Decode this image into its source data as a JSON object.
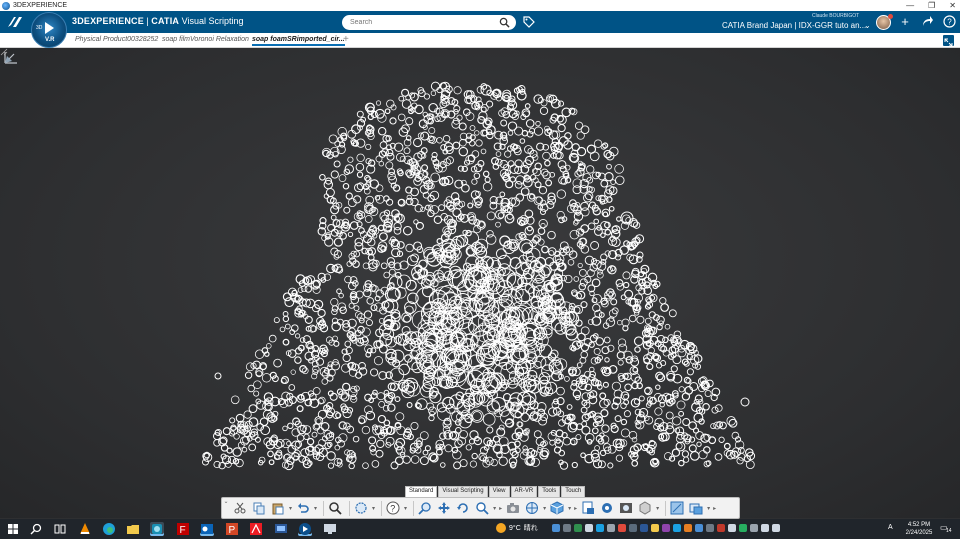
{
  "os": {
    "window_title": "3DEXPERIENCE",
    "controls": [
      "—",
      "❐",
      "✕"
    ]
  },
  "header": {
    "brand_bold": "3DEXPERIENCE",
    "brand_sep": " | ",
    "brand_app_bold": "CATIA",
    "brand_app": " Visual Scripting",
    "compass_version": "V.R",
    "compass_3d": "3D",
    "search_placeholder": "Search",
    "user_name": "Claude BOURBIGOT",
    "tenant": "CATIA Brand Japan | IDX-GGR tuto an...",
    "accent": "#005386"
  },
  "tabs": [
    {
      "label": "Physical Product00328252",
      "active": false
    },
    {
      "label": "soap filmVoronoi Relaxation",
      "active": false
    },
    {
      "label": "soap foamSRimported_cir...",
      "active": true
    }
  ],
  "tab_add_label": "+",
  "viewport": {
    "background": "#2e2f31",
    "foam_color": "#ffffff"
  },
  "action_bar": {
    "tabs": [
      "Standard",
      "Visual Scripting",
      "View",
      "AR-VR",
      "Tools",
      "Touch"
    ],
    "active_tab": "Standard",
    "tools": [
      "scissors-icon",
      "copy-icon",
      "paste-icon",
      "undo-icon",
      "zoom-area-icon",
      "snap-icon",
      "help-icon",
      "zoom-icon",
      "pan-icon",
      "rotate-icon",
      "zoom-in-out-icon",
      "capture-icon",
      "view-icon",
      "cube-view-icon",
      "product-icon",
      "settings-cube-icon",
      "render-icon",
      "shape-icon",
      "compass-icon",
      "layers-icon"
    ]
  },
  "taskbar": {
    "weather_temp": "9°C",
    "weather_text": "晴れ",
    "time": "4:52 PM",
    "date": "2/24/2025",
    "ime": "A",
    "notifications": "14"
  }
}
